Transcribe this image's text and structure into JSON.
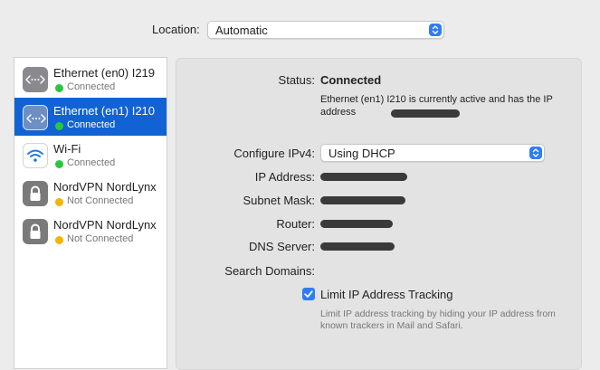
{
  "location": {
    "label": "Location:",
    "value": "Automatic"
  },
  "services": [
    {
      "name": "Ethernet (en0) I219",
      "status": "Connected",
      "status_color": "#28c840",
      "icon": "ethernet-icon",
      "selected": false
    },
    {
      "name": "Ethernet (en1) I210",
      "status": "Connected",
      "status_color": "#28c840",
      "icon": "ethernet-icon",
      "selected": true
    },
    {
      "name": "Wi-Fi",
      "status": "Connected",
      "status_color": "#28c840",
      "icon": "wifi-icon",
      "selected": false
    },
    {
      "name": "NordVPN NordLynx",
      "status": "Not Connected",
      "status_color": "#f5b400",
      "icon": "lock-icon",
      "selected": false
    },
    {
      "name": "NordVPN NordLynx",
      "status": "Not Connected",
      "status_color": "#f5b400",
      "icon": "lock-icon",
      "selected": false
    }
  ],
  "detail": {
    "status_label": "Status:",
    "status_value": "Connected",
    "description": "Ethernet (en1) I210 is currently active and has the IP address",
    "configure_label": "Configure IPv4:",
    "configure_value": "Using DHCP",
    "ip_label": "IP Address:",
    "subnet_label": "Subnet Mask:",
    "router_label": "Router:",
    "dns_label": "DNS Server:",
    "search_label": "Search Domains:",
    "limit_label": "Limit IP Address Tracking",
    "limit_checked": true,
    "limit_help": "Limit IP address tracking by hiding your IP address from known trackers in Mail and Safari."
  },
  "colors": {
    "accent": "#2f7cf6",
    "selection": "#1163d3"
  }
}
